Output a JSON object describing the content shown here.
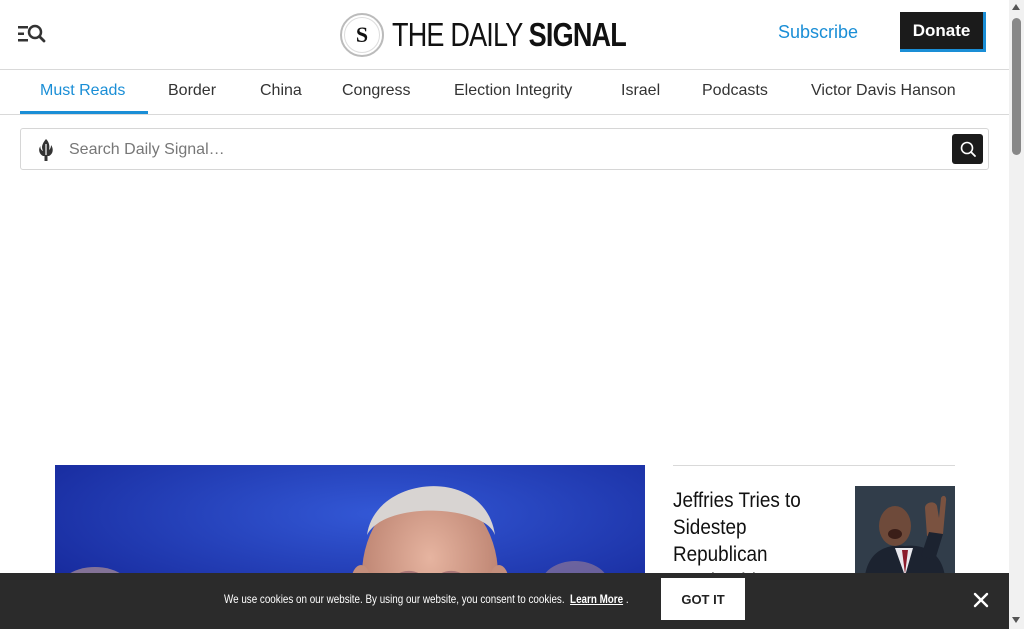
{
  "header": {
    "menu_icon": "menu-search-icon",
    "logo_seal_letter": "S",
    "logo_text_thin": "THE DAILY ",
    "logo_text_bold": "SIGNAL",
    "subscribe_label": "Subscribe",
    "donate_label": "Donate"
  },
  "nav": {
    "items": [
      {
        "label": "Must Reads",
        "active": true
      },
      {
        "label": "Border",
        "active": false
      },
      {
        "label": "China",
        "active": false
      },
      {
        "label": "Congress",
        "active": false
      },
      {
        "label": "Election Integrity",
        "active": false
      },
      {
        "label": "Israel",
        "active": false
      },
      {
        "label": "Podcasts",
        "active": false
      },
      {
        "label": "Victor Davis Hanson",
        "active": false
      }
    ]
  },
  "search": {
    "placeholder": "Search Daily Signal…",
    "value": "",
    "logo_icon": "torch-icon",
    "button_icon": "search-icon"
  },
  "main": {
    "sidebar_headline": "Jeffries Tries to Sidestep Republican Leadership on Health"
  },
  "cookie": {
    "text": "We use cookies on our website. By using our website, you consent to cookies.",
    "learn_more": "Learn More",
    "period": ".",
    "got_it": "GOT IT",
    "close_icon": "close-icon"
  },
  "colors": {
    "accent": "#1a8ed6",
    "dark": "#1b1b1b",
    "cookie_bg": "#2b2b2b"
  }
}
